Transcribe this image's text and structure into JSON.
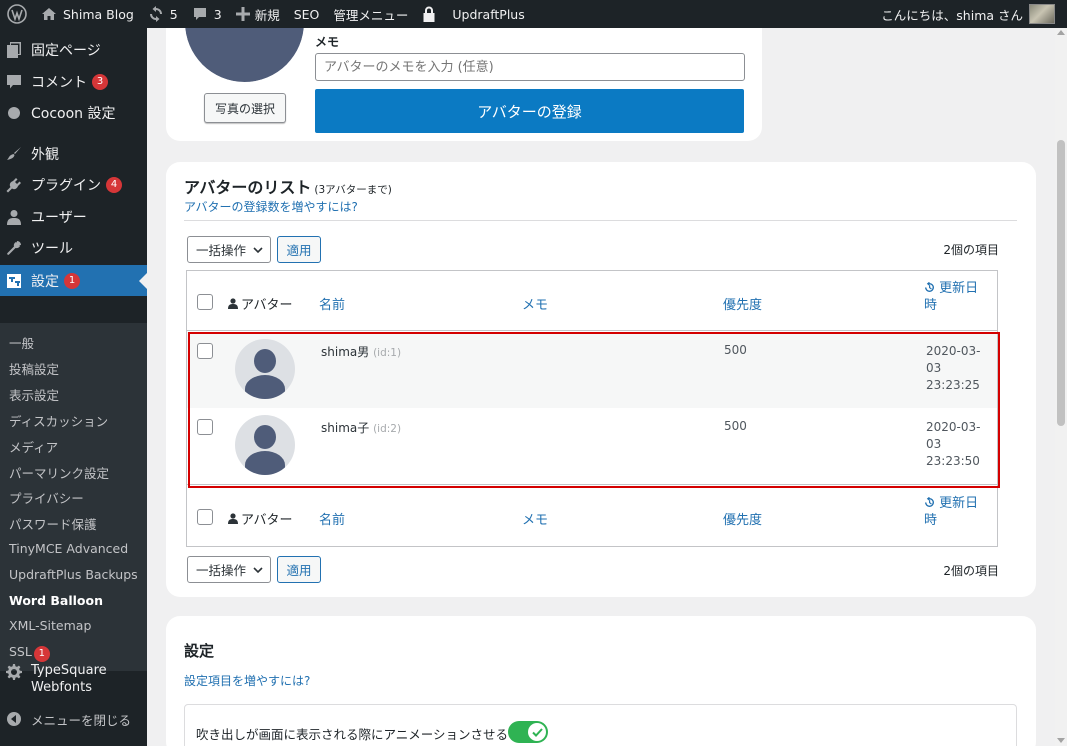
{
  "adminbar": {
    "site_name": "Shima Blog",
    "updates_count": "5",
    "comments_count": "3",
    "new_label": "新規",
    "seo_label": "SEO",
    "admin_menu_label": "管理メニュー",
    "updraft_label": "UpdraftPlus",
    "greeting": "こんにちは、shima さん"
  },
  "sidebar": {
    "items": [
      {
        "label": "固定ページ",
        "icon": "page-icon"
      },
      {
        "label": "コメント",
        "icon": "comment-icon",
        "badge": "3"
      },
      {
        "label": "Cocoon 設定",
        "icon": "circle-icon"
      },
      {
        "label": "外観",
        "icon": "brush-icon"
      },
      {
        "label": "プラグイン",
        "icon": "plugin-icon",
        "badge": "4"
      },
      {
        "label": "ユーザー",
        "icon": "user-icon"
      },
      {
        "label": "ツール",
        "icon": "wrench-icon"
      },
      {
        "label": "設定",
        "icon": "settings-icon",
        "badge": "1"
      }
    ],
    "submenu": [
      {
        "label": "一般"
      },
      {
        "label": "投稿設定"
      },
      {
        "label": "表示設定"
      },
      {
        "label": "ディスカッション"
      },
      {
        "label": "メディア"
      },
      {
        "label": "パーマリンク設定"
      },
      {
        "label": "プライバシー"
      },
      {
        "label": "パスワード保護"
      },
      {
        "label": "TinyMCE Advanced"
      },
      {
        "label": "UpdraftPlus Backups"
      },
      {
        "label": "Word Balloon"
      },
      {
        "label": "XML-Sitemap"
      },
      {
        "label": "SSL",
        "badge": "1"
      }
    ],
    "typesquare_label_1": "TypeSquare",
    "typesquare_label_2": "Webfonts",
    "collapse_label": "メニューを閉じる"
  },
  "register": {
    "memo_label": "メモ",
    "memo_placeholder": "アバターのメモを入力 (任意)",
    "select_photo_label": "写真の選択",
    "register_label": "アバターの登録"
  },
  "list": {
    "title": "アバターのリスト",
    "limit_note": "(3アバターまで)",
    "increase_link": "アバターの登録数を増やすには?",
    "bulk_label": "一括操作",
    "apply_label": "適用",
    "item_count": "2個の項目",
    "columns": {
      "avatar": "アバター",
      "name": "名前",
      "memo": "メモ",
      "priority": "優先度",
      "updated_1": "更新日",
      "updated_2": "時"
    },
    "rows": [
      {
        "name": "shima男",
        "id": "(id:1)",
        "priority": "500",
        "date": "2020-03-",
        "time": "03 23:23:25"
      },
      {
        "name": "shima子",
        "id": "(id:2)",
        "priority": "500",
        "date": "2020-03-",
        "time": "03 23:23:50"
      }
    ]
  },
  "settings": {
    "title": "設定",
    "increase_link": "設定項目を増やすには?",
    "animation_label": "吹き出しが画面に表示される際にアニメーションさせる",
    "animation_enabled": true
  },
  "colors": {
    "accent": "#2271b1",
    "highlight_border": "#d40000",
    "toggle_on": "#2fb353"
  }
}
